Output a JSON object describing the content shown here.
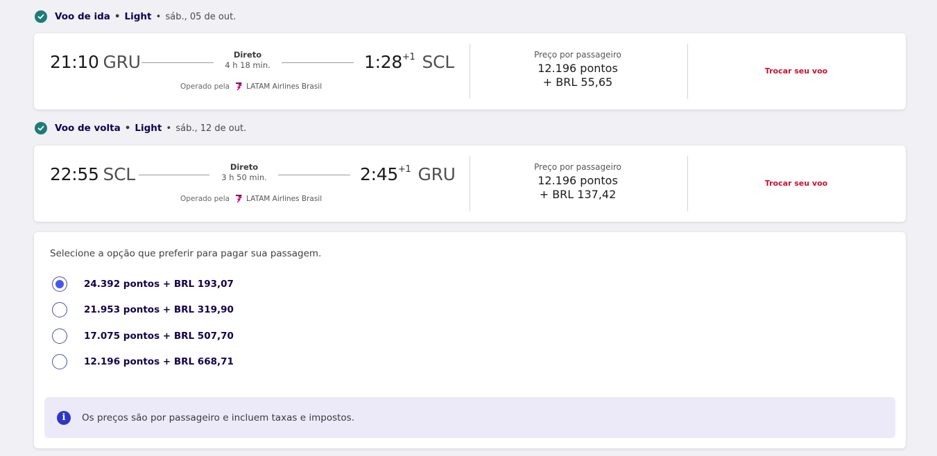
{
  "outbound": {
    "header": {
      "label": "Voo de ida",
      "fare": "Light",
      "date": "sáb., 05 de out."
    },
    "departure": {
      "time": "21:10",
      "airport": "GRU"
    },
    "arrival": {
      "time": "1:28",
      "day_offset": "+1",
      "airport": "SCL"
    },
    "stops": "Direto",
    "duration": "4 h 18 min.",
    "operated_by_label": "Operado pela",
    "airline": "LATAM Airlines Brasil",
    "price_label": "Preço por passageiro",
    "price_points": "12.196 pontos",
    "price_brl": "+ BRL 55,65",
    "change_label": "Trocar seu voo"
  },
  "return": {
    "header": {
      "label": "Voo de volta",
      "fare": "Light",
      "date": "sáb., 12 de out."
    },
    "departure": {
      "time": "22:55",
      "airport": "SCL"
    },
    "arrival": {
      "time": "2:45",
      "day_offset": "+1",
      "airport": "GRU"
    },
    "stops": "Direto",
    "duration": "3 h 50 min.",
    "operated_by_label": "Operado pela",
    "airline": "LATAM Airlines Brasil",
    "price_label": "Preço por passageiro",
    "price_points": "12.196 pontos",
    "price_brl": "+ BRL 137,42",
    "change_label": "Trocar seu voo"
  },
  "payment": {
    "title": "Selecione a opção que preferir para pagar sua passagem.",
    "options": [
      {
        "label": "24.392 pontos + BRL 193,07",
        "selected": true
      },
      {
        "label": "21.953 pontos + BRL 319,90",
        "selected": false
      },
      {
        "label": "17.075 pontos + BRL 507,70",
        "selected": false
      },
      {
        "label": "12.196 pontos + BRL 668,71",
        "selected": false
      }
    ],
    "info": "Os preços são por passageiro e incluem taxas e impostos."
  },
  "colors": {
    "check": "#1f7a78",
    "link": "#c8102e",
    "radio_selected": "#4658e8",
    "info_icon": "#2d36c7",
    "info_bg": "#eceaf8"
  },
  "icons": {
    "check": "check-circle-icon",
    "airline": "latam-logo-icon",
    "info": "info-icon"
  }
}
